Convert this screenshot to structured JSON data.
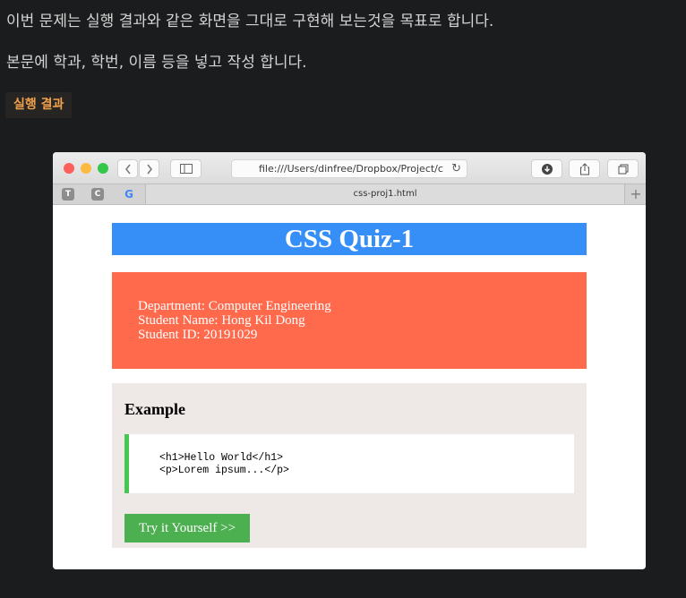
{
  "intro": {
    "line1": "이번 문제는 실행 결과와 같은 화면을 그대로 구현해 보는것을 목표로 합니다.",
    "line2": "본문에 학과, 학번, 이름 등을 넣고 작성 합니다.",
    "result_label": "실행 결과"
  },
  "browser": {
    "url": "file:///Users/dinfree/Dropbox/Project/c",
    "tab_title": "css-proj1.html",
    "pinned_tabs": [
      "T",
      "C",
      "G"
    ]
  },
  "page": {
    "title": "CSS Quiz-1",
    "info": {
      "department": "Department: Computer Engineering",
      "student_name": "Student Name: Hong Kil Dong",
      "student_id": "Student ID: 20191029"
    },
    "example": {
      "heading": "Example",
      "code_line1": "<h1>Hello World</h1>",
      "code_line2": "<p>Lorem ipsum...</p>",
      "button": "Try it Yourself >>"
    }
  },
  "colors": {
    "title_bg": "#368ff7",
    "info_bg": "#ff6a4d",
    "example_bg": "#eee8e6",
    "code_border": "#47c652",
    "button_bg": "#4caf50",
    "result_label": "#f0a04b"
  }
}
